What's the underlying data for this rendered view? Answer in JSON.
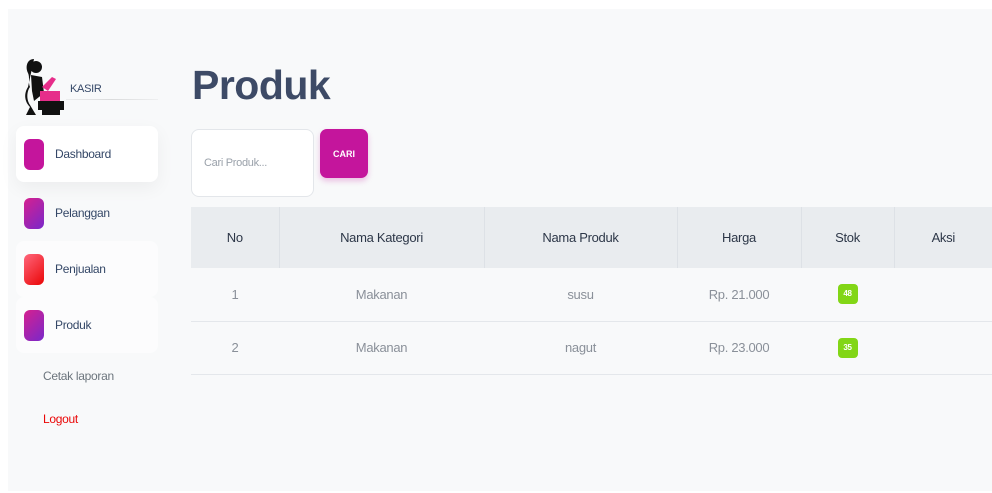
{
  "sidebar": {
    "brand": "KASIR",
    "items": [
      {
        "label": "Dashboard",
        "icon": "dashboard-icon",
        "color": "#c4159c"
      },
      {
        "label": "Pelanggan",
        "icon": "customers-icon",
        "color": "#b52bc4"
      },
      {
        "label": "Penjualan",
        "icon": "sales-icon",
        "color": "#ea0606"
      },
      {
        "label": "Produk",
        "icon": "products-icon",
        "color": "#b52bc4"
      }
    ],
    "cetak": "Cetak laporan",
    "logout": "Logout"
  },
  "main": {
    "title": "Produk",
    "search": {
      "placeholder": "Cari Produk...",
      "value": "",
      "button": "CARI"
    },
    "table": {
      "headers": [
        "No",
        "Nama Kategori",
        "Nama Produk",
        "Harga",
        "Stok",
        "Aksi"
      ],
      "rows": [
        {
          "no": "1",
          "kategori": "Makanan",
          "produk": "susu",
          "harga": "Rp. 21.000",
          "stok": "48",
          "aksi": ""
        },
        {
          "no": "2",
          "kategori": "Makanan",
          "produk": "nagut",
          "harga": "Rp. 23.000",
          "stok": "35",
          "aksi": ""
        }
      ]
    }
  },
  "colors": {
    "accent": "#c4159c",
    "stok_badge": "#82d616",
    "logout": "#ea0606"
  }
}
